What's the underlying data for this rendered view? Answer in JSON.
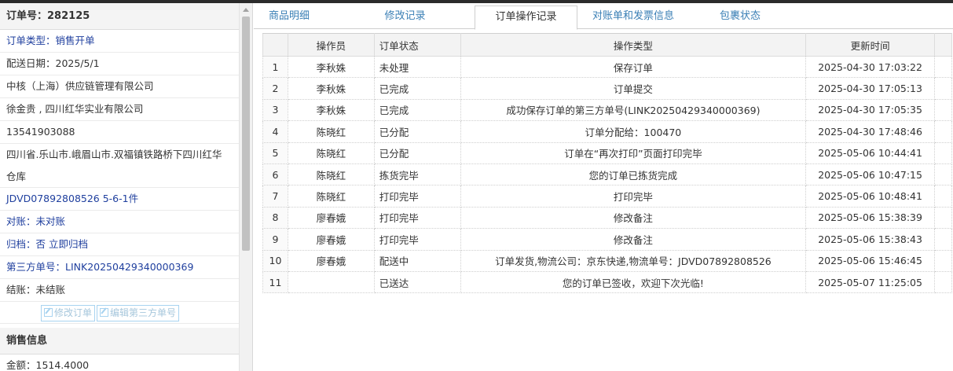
{
  "order": {
    "title_label": "订单号：",
    "title_value": "282125",
    "type": "订单类型：销售开单",
    "delivery_date": "配送日期：2025/5/1",
    "company": "中核（上海）供应链管理有限公司",
    "contact": "徐金贵 , 四川红华实业有限公司",
    "phone": "13541903088",
    "address": "四川省.乐山市.峨眉山市.双福镇铁路桥下四川红华仓库",
    "tracking": "JDVD07892808526 5-6-1件",
    "reconcile": "对账：未对账",
    "archive_label": "归档：",
    "archive_value": "否",
    "archive_link": "立即归档",
    "third_party": "第三方单号：LINK20250429340000369",
    "settlement": "结账：未结账",
    "edit_order_btn": "修改订单",
    "edit_third_btn": "编辑第三方单号"
  },
  "sales": {
    "title": "销售信息",
    "amount": "金额：1514.4000"
  },
  "tabs": [
    {
      "label": "商品明细",
      "active": false
    },
    {
      "label": "修改记录",
      "active": false
    },
    {
      "label": "订单操作记录",
      "active": true
    },
    {
      "label": "对账单和发票信息",
      "active": false
    },
    {
      "label": "包裹状态",
      "active": false
    }
  ],
  "table": {
    "headers": [
      "",
      "操作员",
      "订单状态",
      "操作类型",
      "更新时间"
    ],
    "rows": [
      {
        "no": "1",
        "operator": "李秋姝",
        "status": "未处理",
        "action": "保存订单",
        "time": "2025-04-30 17:03:22"
      },
      {
        "no": "2",
        "operator": "李秋姝",
        "status": "已完成",
        "action": "订单提交",
        "time": "2025-04-30 17:05:13"
      },
      {
        "no": "3",
        "operator": "李秋姝",
        "status": "已完成",
        "action": "成功保存订单的第三方单号(LINK20250429340000369)",
        "time": "2025-04-30 17:05:35"
      },
      {
        "no": "4",
        "operator": "陈晓红",
        "status": "已分配",
        "action": "订单分配给：100470",
        "time": "2025-04-30 17:48:46"
      },
      {
        "no": "5",
        "operator": "陈晓红",
        "status": "已分配",
        "action": "订单在“再次打印”页面打印完毕",
        "time": "2025-05-06 10:44:41"
      },
      {
        "no": "6",
        "operator": "陈晓红",
        "status": "拣货完毕",
        "action": "您的订单已拣货完成",
        "time": "2025-05-06 10:47:15"
      },
      {
        "no": "7",
        "operator": "陈晓红",
        "status": "打印完毕",
        "action": "打印完毕",
        "time": "2025-05-06 10:48:41"
      },
      {
        "no": "8",
        "operator": "廖春娥",
        "status": "打印完毕",
        "action": "修改备注",
        "time": "2025-05-06 15:38:39"
      },
      {
        "no": "9",
        "operator": "廖春娥",
        "status": "打印完毕",
        "action": "修改备注",
        "time": "2025-05-06 15:38:43"
      },
      {
        "no": "10",
        "operator": "廖春娥",
        "status": "配送中",
        "action": "订单发货,物流公司：京东快递,物流单号：JDVD07892808526",
        "time": "2025-05-06 15:46:45"
      },
      {
        "no": "11",
        "operator": "",
        "status": "已送达",
        "action": "您的订单已签收，欢迎下次光临!",
        "time": "2025-05-07 11:25:05"
      }
    ]
  }
}
